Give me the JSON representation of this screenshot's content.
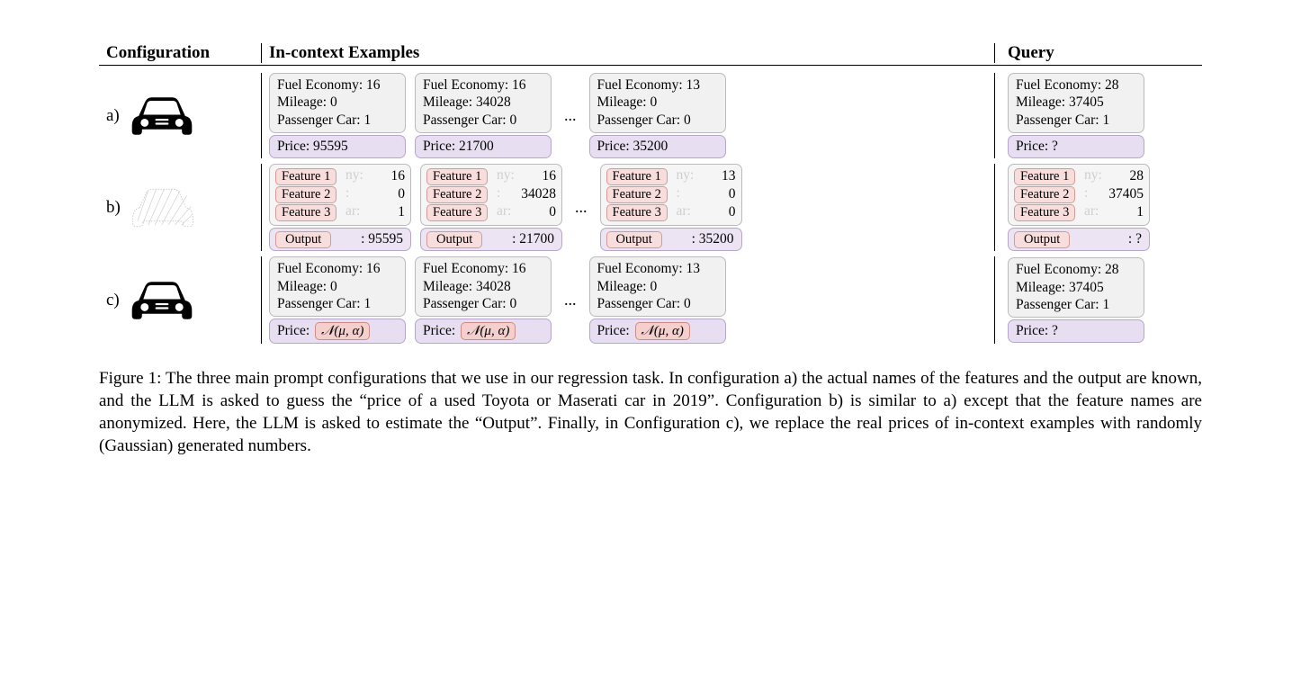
{
  "header": {
    "config": "Configuration",
    "examples": "In-context Examples",
    "query": "Query"
  },
  "labels": {
    "a": "a)",
    "b": "b)",
    "c": "c)",
    "dots": "..."
  },
  "feature_names": {
    "f1": "Fuel Economy",
    "f2": "Mileage",
    "f3": "Passenger Car",
    "out": "Price"
  },
  "anon_names": {
    "f1": "Feature 1",
    "f2": "Feature 2",
    "f3": "Feature 3",
    "out": "Output"
  },
  "ghost_suffix": {
    "f1": "ny:",
    "f2": ":",
    "f3": "ar:"
  },
  "row_a": {
    "examples": [
      {
        "f1": "16",
        "f2": "0",
        "f3": "1",
        "price": "95595"
      },
      {
        "f1": "16",
        "f2": "34028",
        "f3": "0",
        "price": "21700"
      },
      {
        "f1": "13",
        "f2": "0",
        "f3": "0",
        "price": "35200"
      }
    ],
    "query": {
      "f1": "28",
      "f2": "37405",
      "f3": "1",
      "price": "?"
    }
  },
  "row_b": {
    "examples": [
      {
        "f1": "16",
        "f2": "0",
        "f3": "1",
        "out": "95595"
      },
      {
        "f1": "16",
        "f2": "34028",
        "f3": "0",
        "out": "21700"
      },
      {
        "f1": "13",
        "f2": "0",
        "f3": "0",
        "out": "35200"
      }
    ],
    "query": {
      "f1": "28",
      "f2": "37405",
      "f3": "1",
      "out": "?"
    }
  },
  "row_c": {
    "examples": [
      {
        "f1": "16",
        "f2": "0",
        "f3": "1"
      },
      {
        "f1": "16",
        "f2": "34028",
        "f3": "0"
      },
      {
        "f1": "13",
        "f2": "0",
        "f3": "0"
      }
    ],
    "query": {
      "f1": "28",
      "f2": "37405",
      "f3": "1",
      "price": "?"
    },
    "gauss": "𝒩(μ, α)"
  },
  "caption": "Figure 1: The three main prompt configurations that we use in our regression task. In configuration a) the actual names of the features and the output are known, and the LLM is asked to guess the “price of a used Toyota or Maserati car in 2019”. Configuration b) is similar to a) except that the feature names are anonymized. Here, the LLM is asked to estimate the “Output”. Finally, in Configuration c), we replace the real prices of in-context examples with randomly (Gaussian) generated numbers."
}
